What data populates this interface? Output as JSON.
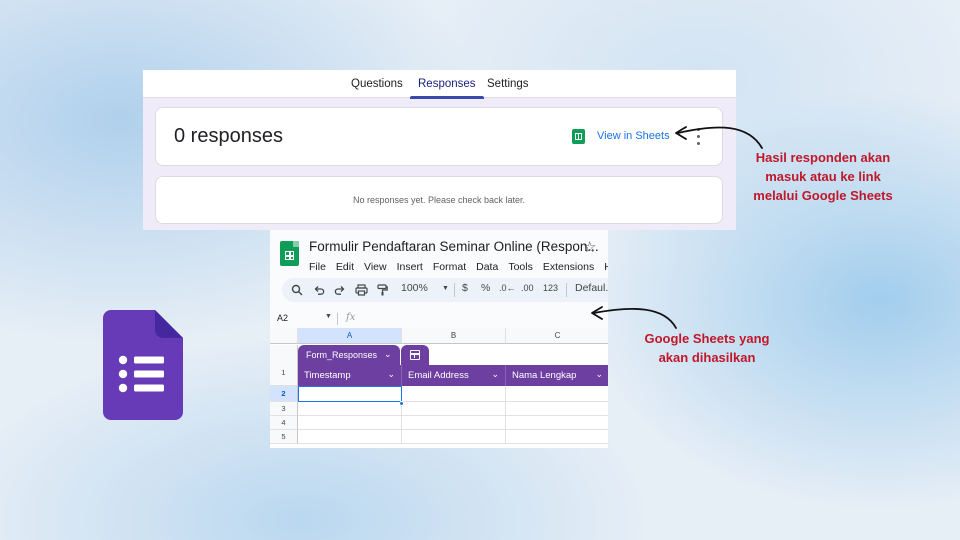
{
  "forms": {
    "tabs": [
      {
        "label": "Questions"
      },
      {
        "label": "Responses"
      },
      {
        "label": "Settings"
      }
    ],
    "active_tab": "Responses",
    "response_count": "0 responses",
    "view_in_sheets": "View in Sheets",
    "empty_message": "No responses yet. Please check back later."
  },
  "sheets": {
    "doc_title": "Formulir Pendaftaran Seminar Online (Respon...",
    "menu": [
      "File",
      "Edit",
      "View",
      "Insert",
      "Format",
      "Data",
      "Tools",
      "Extensions",
      "He"
    ],
    "toolbar": {
      "zoom": "100%",
      "currency": "$",
      "percent": "%",
      "decrease_decimal": ".0←",
      "increase_decimal": ".00",
      "number_format": "123",
      "font": "Defaul..."
    },
    "name_box": "A2",
    "fx_label": "fx",
    "columns": [
      "A",
      "B",
      "C"
    ],
    "rows": [
      "1",
      "2",
      "3",
      "4",
      "5"
    ],
    "table_name": "Form_Responses",
    "headers": [
      "Timestamp",
      "Email Address",
      "Nama Lengkap"
    ]
  },
  "annotations": {
    "top": [
      "Hasil responden akan",
      "masuk atau ke link",
      "melalui Google Sheets"
    ],
    "bottom": [
      "Google Sheets yang",
      "akan dihasilkan"
    ]
  },
  "colors": {
    "annotation": "#c0172a",
    "forms_purple": "#673ab7",
    "table_purple": "#6c3fa0",
    "sheets_green": "#0f9d58",
    "link_blue": "#1a73e8"
  },
  "icons": {
    "sheets": "sheets-icon",
    "forms": "google-forms-icon",
    "star": "star-icon",
    "more": "more-vert-icon"
  }
}
